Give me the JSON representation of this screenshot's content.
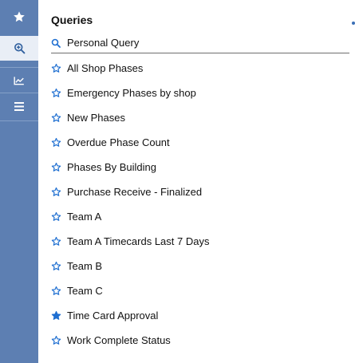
{
  "sidebar": {
    "buttons": [
      {
        "name": "favorites",
        "icon": "star-icon"
      },
      {
        "name": "queries",
        "icon": "search-plus-icon"
      },
      {
        "name": "charts",
        "icon": "chart-icon"
      },
      {
        "name": "menu",
        "icon": "menu-icon"
      }
    ]
  },
  "panel": {
    "title": "Queries",
    "personal_query": {
      "label": "Personal Query",
      "icon": "search-icon"
    }
  },
  "queries": [
    {
      "label": "All Shop Phases",
      "starred": false
    },
    {
      "label": "Emergency Phases by shop",
      "starred": false
    },
    {
      "label": "New Phases",
      "starred": false
    },
    {
      "label": "Overdue Phase Count",
      "starred": false
    },
    {
      "label": "Phases By Building",
      "starred": false
    },
    {
      "label": "Purchase Receive - Finalized",
      "starred": false
    },
    {
      "label": "Team A",
      "starred": false
    },
    {
      "label": "Team A Timecards Last 7 Days",
      "starred": false
    },
    {
      "label": "Team B",
      "starred": false
    },
    {
      "label": "Team C",
      "starred": false
    },
    {
      "label": "Time Card Approval",
      "starred": true
    },
    {
      "label": "Work Complete Status",
      "starred": false
    }
  ],
  "colors": {
    "rail": "#5d7fb2",
    "accent": "#1f6fd1",
    "active_rail_button": "#e9eef6"
  }
}
